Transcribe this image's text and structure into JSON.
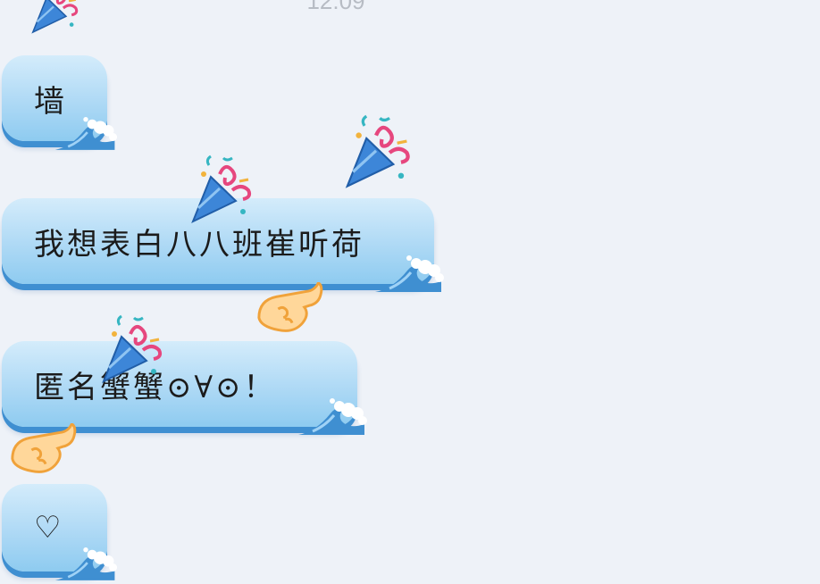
{
  "chat": {
    "timestamp": "12:09",
    "messages": [
      {
        "text": "墙"
      },
      {
        "text": "我想表白八八班崔听荷"
      },
      {
        "text": "匿名蟹蟹⊙∀⊙！"
      },
      {
        "text": "♡"
      }
    ]
  },
  "decorations": {
    "party_popper": "party-popper-icon",
    "pointing_hand": "pointing-hand-icon",
    "wave": "wave-icon"
  },
  "colors": {
    "background": "#eef2f8",
    "bubble_top": "#d4ecfb",
    "bubble_bottom": "#8ecbf0",
    "bubble_edge": "#3f8fd1"
  }
}
